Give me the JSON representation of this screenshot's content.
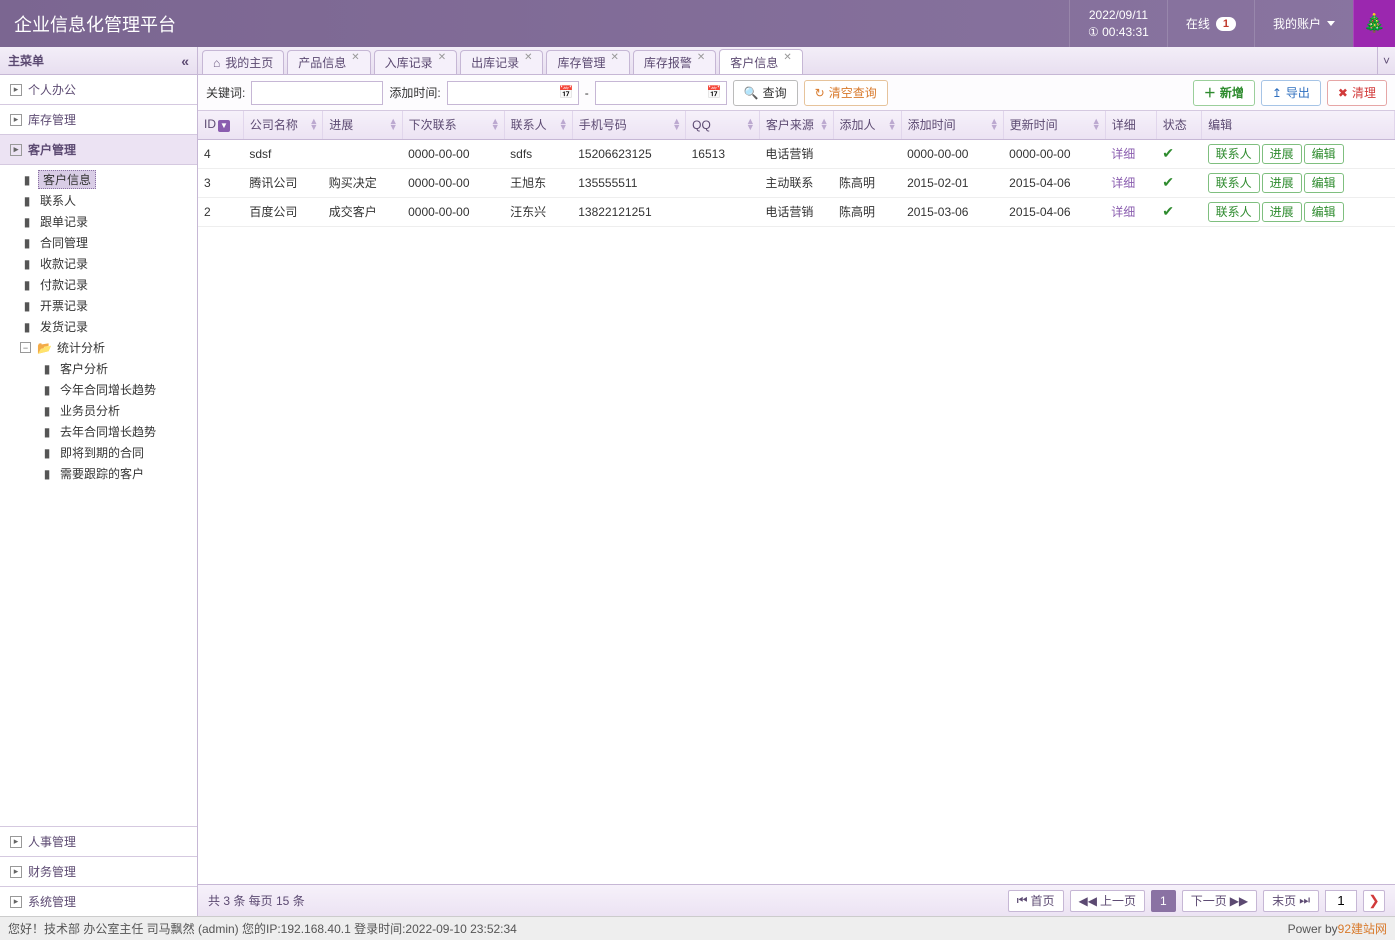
{
  "header": {
    "title": "企业信息化管理平台",
    "date": "2022/09/11",
    "clock_icon": "①",
    "time": "00:43:31",
    "online_label": "在线",
    "online_count": "1",
    "account_label": "我的账户"
  },
  "sidebar": {
    "title": "主菜单",
    "panels": [
      {
        "label": "个人办公"
      },
      {
        "label": "库存管理"
      },
      {
        "label": "客户管理"
      },
      {
        "label": "人事管理"
      },
      {
        "label": "财务管理"
      },
      {
        "label": "系统管理"
      }
    ],
    "tree": [
      {
        "label": "客户信息",
        "selected": true
      },
      {
        "label": "联系人"
      },
      {
        "label": "跟单记录"
      },
      {
        "label": "合同管理"
      },
      {
        "label": "收款记录"
      },
      {
        "label": "付款记录"
      },
      {
        "label": "开票记录"
      },
      {
        "label": "发货记录"
      },
      {
        "label": "统计分析",
        "folder": true,
        "expanded": true,
        "children": [
          {
            "label": "客户分析"
          },
          {
            "label": "今年合同增长趋势"
          },
          {
            "label": "业务员分析"
          },
          {
            "label": "去年合同增长趋势"
          },
          {
            "label": "即将到期的合同"
          },
          {
            "label": "需要跟踪的客户"
          }
        ]
      }
    ]
  },
  "tabs": [
    {
      "label": "我的主页",
      "home": true
    },
    {
      "label": "产品信息",
      "closable": true
    },
    {
      "label": "入库记录",
      "closable": true
    },
    {
      "label": "出库记录",
      "closable": true
    },
    {
      "label": "库存管理",
      "closable": true
    },
    {
      "label": "库存报警",
      "closable": true
    },
    {
      "label": "客户信息",
      "closable": true,
      "active": true
    }
  ],
  "toolbar": {
    "keyword_label": "关键词:",
    "addtime_label": "添加时间:",
    "date_sep": "-",
    "search": "查询",
    "clear_search": "清空查询",
    "add": "新增",
    "export": "导出",
    "clean": "清理"
  },
  "columns": [
    "ID",
    "公司名称",
    "进展",
    "下次联系",
    "联系人",
    "手机号码",
    "QQ",
    "客户来源",
    "添加人",
    "添加时间",
    "更新时间",
    "详细",
    "状态",
    "编辑"
  ],
  "rows": [
    {
      "id": "4",
      "company": "sdsf",
      "progress": "",
      "next": "0000-00-00",
      "contact": "sdfs",
      "mobile": "15206623125",
      "qq": "16513",
      "source": "电话营销",
      "adder": "",
      "addtime": "0000-00-00",
      "updtime": "0000-00-00"
    },
    {
      "id": "3",
      "company": "腾讯公司",
      "progress": "购买决定",
      "next": "0000-00-00",
      "contact": "王旭东",
      "mobile": "135555511",
      "qq": "",
      "source": "主动联系",
      "adder": "陈高明",
      "addtime": "2015-02-01",
      "updtime": "2015-04-06"
    },
    {
      "id": "2",
      "company": "百度公司",
      "progress": "成交客户",
      "next": "0000-00-00",
      "contact": "汪东兴",
      "mobile": "13822121251",
      "qq": "",
      "source": "电话营销",
      "adder": "陈高明",
      "addtime": "2015-03-06",
      "updtime": "2015-04-06"
    }
  ],
  "row_actions": {
    "detail": "详细",
    "contact": "联系人",
    "progress": "进展",
    "edit": "编辑"
  },
  "pager": {
    "summary": "共 3 条 每页 15 条",
    "first": "首页",
    "prev": "上一页",
    "current": "1",
    "next": "下一页",
    "last": "末页",
    "goto": "1"
  },
  "footer": {
    "greeting": "您好！技术部 办公室主任 司马飘然 (admin) 您的IP:192.168.40.1 登录时间:2022-09-10 23:52:34",
    "power": "Power by ",
    "link": "92建站网"
  }
}
